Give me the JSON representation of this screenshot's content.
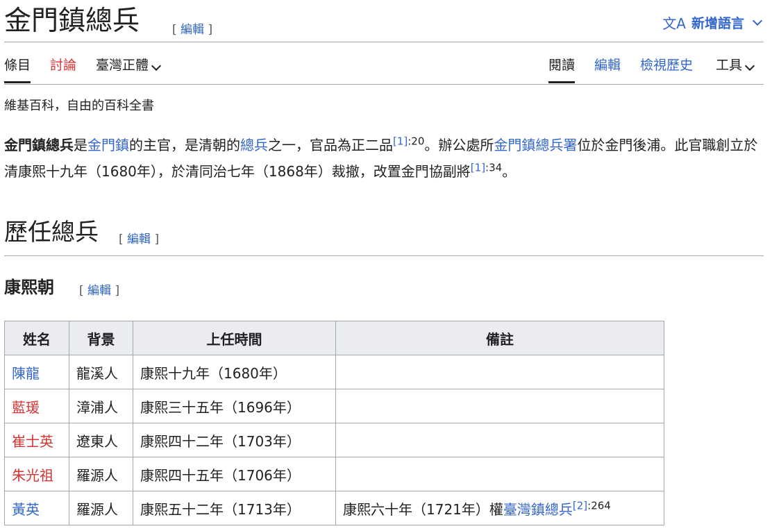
{
  "title": "金門鎮總兵",
  "edit_label": "編輯",
  "bracket_open": "[",
  "bracket_close": "]",
  "lang": {
    "icon": "文A",
    "label": "新增語言"
  },
  "tabs_left": [
    "條目",
    "討論",
    "臺灣正體"
  ],
  "tabs_right": [
    "閱讀",
    "編輯",
    "檢視歷史",
    "工具"
  ],
  "tagline": "維基百科，自由的百科全書",
  "intro": {
    "p1": "金門鎮總兵",
    "p2": "是",
    "p3": "金門鎮",
    "p4": "的主官，是清朝的",
    "p5": "總兵",
    "p6": "之一，官品為正二品",
    "ref1": "[1]",
    "ref1_page": ":20",
    "p7": "。辦公處所",
    "p8": "金門鎮總兵署",
    "p9": "位於金門後浦。此官職創立於清康熙十九年（1680年），於清同治七年（1868年）裁撤，改置金門協副將",
    "ref2": "[1]",
    "ref2_page": ":34",
    "p10": "。"
  },
  "section_title": "歷任總兵",
  "subsection_title": "康熙朝",
  "table": {
    "headers": [
      "姓名",
      "背景",
      "上任時間",
      "備註"
    ],
    "rows": [
      {
        "name": "陳龍",
        "bg": "龍溪人",
        "time": "康熙十九年（1680年）",
        "note": ""
      },
      {
        "name": "藍瑗",
        "bg": "漳浦人",
        "time": "康熙三十五年（1696年）",
        "note": ""
      },
      {
        "name": "崔士英",
        "bg": "遼東人",
        "time": "康熙四十二年（1703年）",
        "note": ""
      },
      {
        "name": "朱光祖",
        "bg": "羅源人",
        "time": "康熙四十五年（1706年）",
        "note": ""
      },
      {
        "name": "黃英",
        "bg": "羅源人",
        "time": "康熙五十二年（1713年）",
        "note_pre": "康熙六十年（1721年）權",
        "note_link": "臺灣鎮總兵",
        "note_ref": "[2]",
        "note_ref_page": ":264"
      }
    ]
  },
  "colors": {
    "link": "#3366cc",
    "redlink": "#d73333",
    "text": "#202122",
    "border": "#a2a9b1",
    "header_bg": "#eaecf0"
  }
}
